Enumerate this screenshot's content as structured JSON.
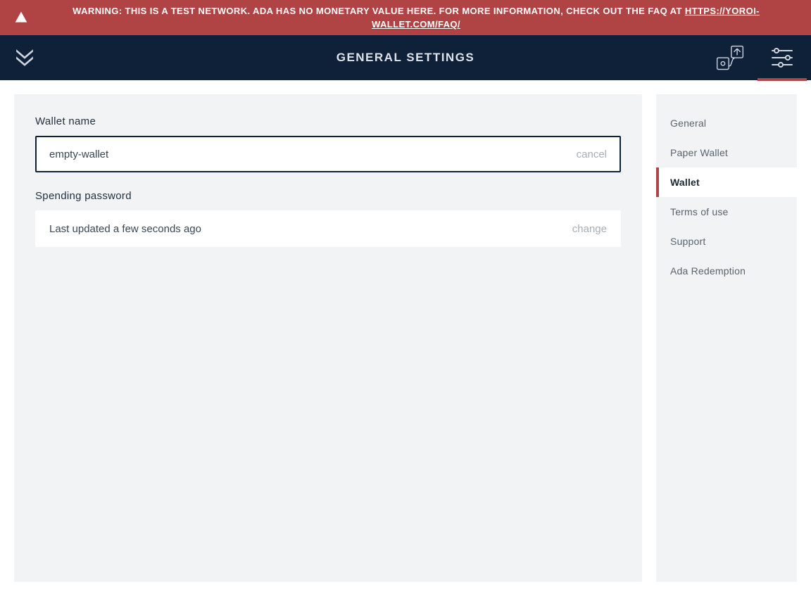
{
  "warning": {
    "text_prefix": "WARNING: THIS IS A TEST NETWORK. ADA HAS NO MONETARY VALUE HERE. FOR MORE INFORMATION, CHECK OUT THE FAQ AT ",
    "link_text": "HTTPS://YOROI-WALLET.COM/FAQ/"
  },
  "header": {
    "title": "GENERAL SETTINGS"
  },
  "main": {
    "wallet_name_label": "Wallet name",
    "wallet_name_value": "empty-wallet",
    "wallet_name_action": "cancel",
    "spending_password_label": "Spending password",
    "spending_password_value": "Last updated a few seconds ago",
    "spending_password_action": "change"
  },
  "sidebar": {
    "items": [
      {
        "label": "General",
        "active": false
      },
      {
        "label": "Paper Wallet",
        "active": false
      },
      {
        "label": "Wallet",
        "active": true
      },
      {
        "label": "Terms of use",
        "active": false
      },
      {
        "label": "Support",
        "active": false
      },
      {
        "label": "Ada Redemption",
        "active": false
      }
    ]
  },
  "colors": {
    "warning_bg": "#b04444",
    "navy": "#0f2039",
    "panel_bg": "#f1f3f5"
  }
}
